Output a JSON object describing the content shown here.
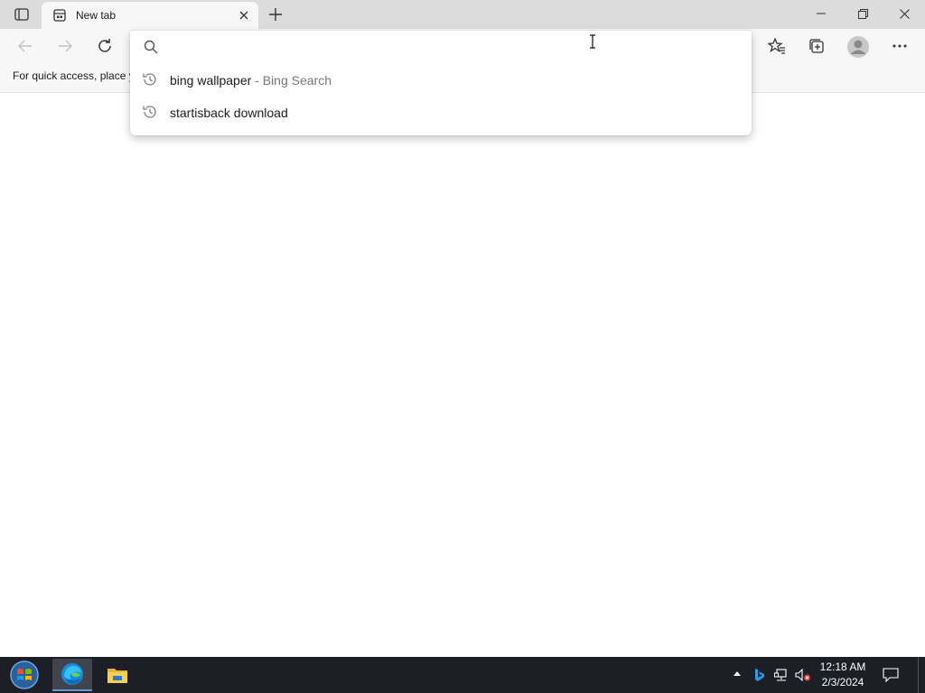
{
  "browser": {
    "tab": {
      "title": "New tab"
    },
    "favorites_bar": {
      "message": "For quick access, place y"
    }
  },
  "omnibox": {
    "value": "",
    "placeholder": "",
    "suggestions": [
      {
        "text": "bing wallpaper",
        "sub": " - Bing Search",
        "icon": "history-icon"
      },
      {
        "text": "startisback download",
        "sub": "",
        "icon": "history-icon"
      }
    ]
  },
  "taskbar": {
    "apps": [
      "start-orb",
      "edge-icon",
      "file-explorer-icon"
    ],
    "clock": {
      "time": "12:18 AM",
      "date": "2/3/2024"
    }
  },
  "colors": {
    "tabstrip": "#dcdcdc",
    "toolbar": "#f7f7f7",
    "taskbar": "#1d1f26"
  }
}
